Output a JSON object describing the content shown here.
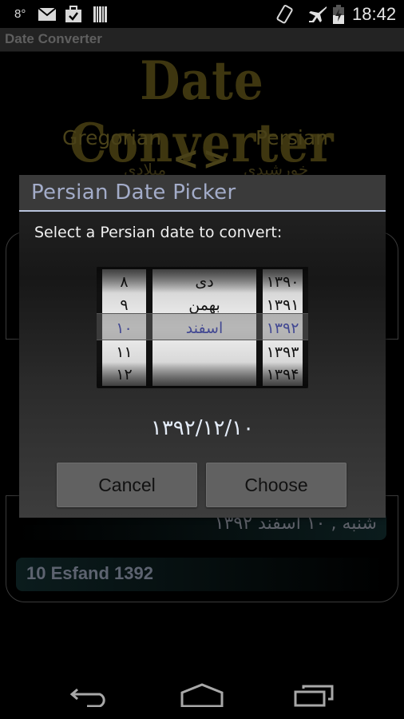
{
  "status_bar": {
    "temperature": "8°",
    "icons": [
      "mail-icon",
      "task-check-icon",
      "barcode-icon",
      "vibrate-icon",
      "airplane-mode-icon",
      "battery-charging-icon"
    ],
    "time": "18:42"
  },
  "action_bar": {
    "title": "Date Converter"
  },
  "background": {
    "logo_text": "Date Converter",
    "gregorian_label": "Gregorian",
    "persian_label": "Persian",
    "swap_arrows": "<>",
    "gregorian_label_fa": "میلادی",
    "persian_label_fa": "خورشیدی",
    "result_persian": "شنبه , ۱۰ اسفند ۱۳۹۲",
    "result_english": "10 Esfand 1392"
  },
  "dialog": {
    "title": "Persian Date Picker",
    "message": "Select a Persian date to convert:",
    "picker": {
      "day": {
        "items": [
          "۸",
          "۹",
          "۱۰",
          "۱۱",
          "۱۲"
        ],
        "selected_index": 2
      },
      "month": {
        "items": [
          "دی",
          "بهمن",
          "اسفند",
          "",
          ""
        ],
        "selected_index": 2
      },
      "year": {
        "items": [
          "۱۳۹۰",
          "۱۳۹۱",
          "۱۳۹۲",
          "۱۳۹۳",
          "۱۳۹۴"
        ],
        "selected_index": 2
      }
    },
    "selected_date": "۱۳۹۲/۱۲/۱۰",
    "cancel_label": "Cancel",
    "choose_label": "Choose"
  },
  "colors": {
    "dialog_title": "#a3acc9",
    "picker_selected": "#1f2ab0",
    "logo_gold": "#3e3610"
  }
}
